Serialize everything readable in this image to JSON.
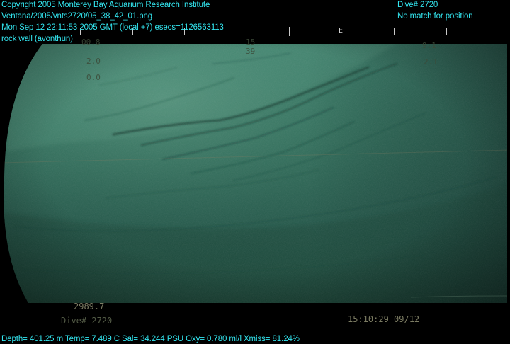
{
  "header": {
    "copyright": "Copyright 2005 Monterey Bay Aquarium Research Institute",
    "file_path": "Ventana/2005/vnts2720/05_38_42_01.png",
    "timestamp": "Mon Sep 12 22:11:53 2005 GMT (local +7)  esecs=1126563113",
    "annotation": "rock wall (avonthun)",
    "dive_number": "Dive# 2720",
    "position_status": "No match for position"
  },
  "footer": {
    "telemetry": "Depth= 401.25 m  Temp= 7.489 C  Sal= 34.244 PSU  Oxy= 0.780 ml/l  Xmiss= 81.24%"
  },
  "camera_overlay": {
    "top_left_1": "00.8",
    "top_left_2": "2.0",
    "top_left_3": "0.0",
    "top_center_1": "15",
    "top_center_2": "39",
    "top_right_1": "9.1",
    "top_right_2": "2.1",
    "depth_readout": "2989.7",
    "dive_readout": "Dive# 2720",
    "time_readout": "15:10:29 09/12",
    "heading_label": "E"
  },
  "colors": {
    "overlay_text": "#33e6f0",
    "water": "#2f6a58"
  }
}
